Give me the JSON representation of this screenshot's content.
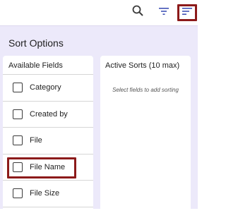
{
  "toolbar": {
    "search_icon": "search-icon",
    "filter_icon": "filter-icon",
    "sort_icon": "sort-icon"
  },
  "sort_panel": {
    "title": "Sort Options",
    "available": {
      "header": "Available Fields",
      "fields": [
        {
          "label": "Category",
          "checked": false
        },
        {
          "label": "Created by",
          "checked": false
        },
        {
          "label": "File",
          "checked": false
        },
        {
          "label": "File Name",
          "checked": false
        },
        {
          "label": "File Size",
          "checked": false
        }
      ]
    },
    "active": {
      "header": "Active Sorts (10 max)",
      "empty_message": "Select fields to add sorting"
    }
  },
  "colors": {
    "panel_background": "#ece9fa",
    "highlight_border": "#8c1a1a",
    "icon_color": "#3f51b5"
  }
}
